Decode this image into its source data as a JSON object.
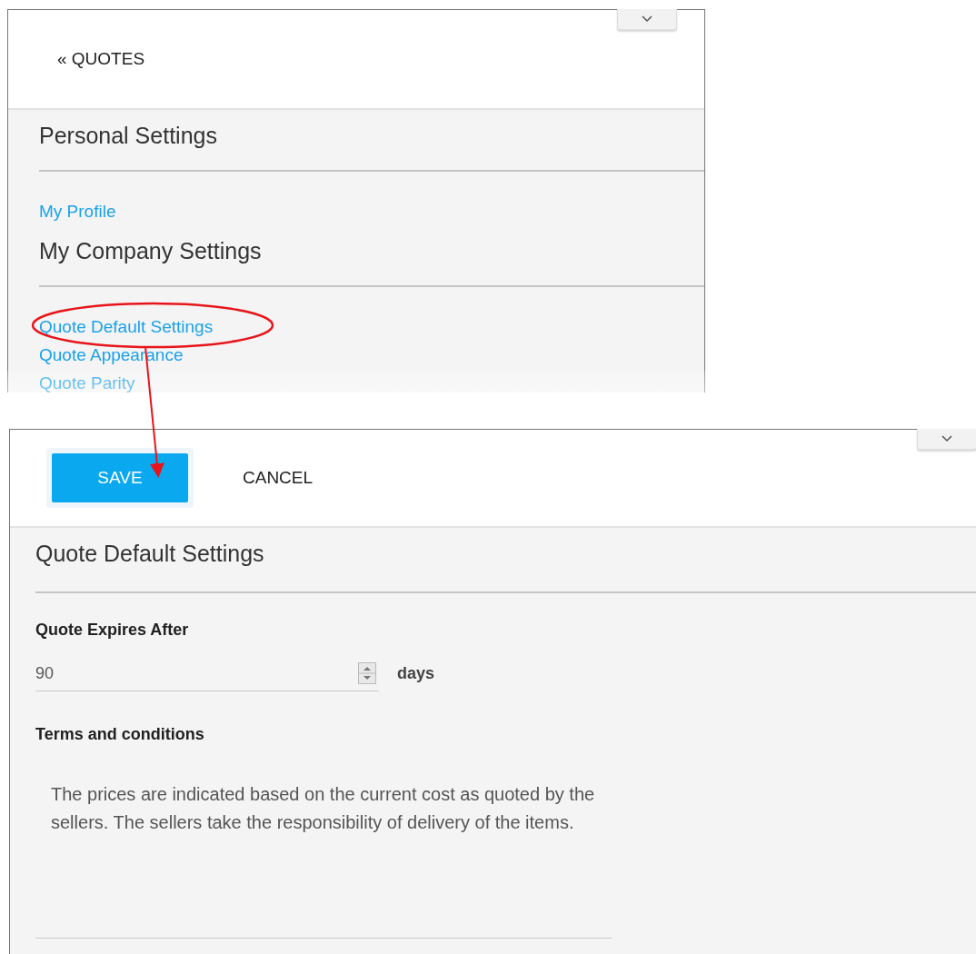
{
  "settings_menu": {
    "back_link": "« QUOTES",
    "sections": [
      {
        "title": "Personal Settings",
        "links": [
          "My Profile"
        ]
      },
      {
        "title": "My Company Settings",
        "links": [
          "Quote Default Settings",
          "Quote Appearance",
          "Quote Parity"
        ]
      }
    ]
  },
  "settings_form": {
    "buttons": [
      {
        "label": "SAVE",
        "kind": "primary"
      },
      {
        "label": "CANCEL",
        "kind": "flat"
      }
    ],
    "title": "Quote Default Settings",
    "expiry": {
      "label": "Quote Expires After",
      "value": "90",
      "unit": "days"
    },
    "terms": {
      "label": "Terms and conditions",
      "value": "The prices are indicated based on the current cost as quoted by the sellers. The sellers take the responsibility of delivery of the items."
    }
  }
}
